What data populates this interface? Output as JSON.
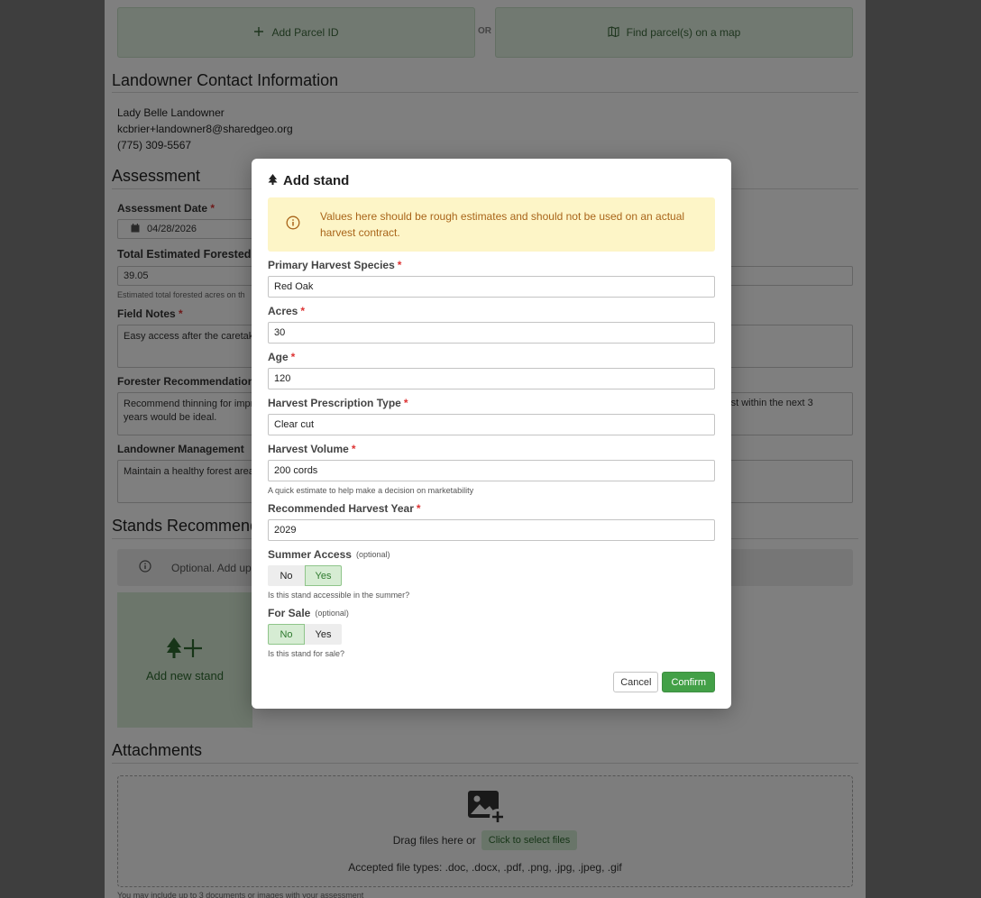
{
  "background": {
    "add_parcel_label": "Add Parcel ID",
    "or_label": "OR",
    "find_parcels_label": "Find parcel(s) on a map",
    "landowner_heading": "Landowner Contact Information",
    "landowner_name": "Lady Belle Landowner",
    "landowner_email": "kcbrier+landowner8@sharedgeo.org",
    "landowner_phone": "(775) 309-5567",
    "assessment_heading": "Assessment",
    "assessment_date_label": "Assessment Date",
    "assessment_date_value": "04/28/2026",
    "forested_acres_label": "Total Estimated Forested",
    "forested_acres_value": "39.05",
    "forested_acres_help": "Estimated total forested acres on th",
    "field_notes_label": "Field Notes",
    "field_notes_value": "Easy access after the caretak",
    "forester_rec_label": "Forester Recommendation",
    "forester_rec_value": "Recommend thinning for impr",
    "forester_rec_line2": "years would be ideal.",
    "forester_rec_tail": "vest within the next 3",
    "landowner_mgmt_label": "Landowner Management",
    "landowner_mgmt_value": "Maintain a healthy forest area",
    "stands_heading": "Stands Recommend",
    "stands_optional_text": "Optional. Add up",
    "add_new_stand_label": "Add new stand",
    "attachments_heading": "Attachments",
    "drag_files_text": "Drag files here or",
    "select_files_label": "Click to select files",
    "accepted_types_text": "Accepted file types: .doc, .docx, .pdf, .png, .jpg, .jpeg, .gif",
    "attachments_help": "You may include up to 3 documents or images with your assessment"
  },
  "modal": {
    "title": "Add stand",
    "alert_text": "Values here should be rough estimates and should not be used on an actual harvest contract.",
    "required_marker": "*",
    "optional_marker": "(optional)",
    "fields": {
      "species": {
        "label": "Primary Harvest Species",
        "value": "Red Oak"
      },
      "acres": {
        "label": "Acres",
        "value": "30"
      },
      "age": {
        "label": "Age",
        "value": "120"
      },
      "prescription": {
        "label": "Harvest Prescription Type",
        "value": "Clear cut"
      },
      "volume": {
        "label": "Harvest Volume",
        "value": "200 cords",
        "help": "A quick estimate to help make a decision on marketability"
      },
      "year": {
        "label": "Recommended Harvest Year",
        "value": "2029"
      }
    },
    "summer_access": {
      "label": "Summer Access",
      "no": "No",
      "yes": "Yes",
      "selected": "Yes",
      "help": "Is this stand accessible in the summer?"
    },
    "for_sale": {
      "label": "For Sale",
      "no": "No",
      "yes": "Yes",
      "selected": "No",
      "help": "Is this stand for sale?"
    },
    "cancel_label": "Cancel",
    "confirm_label": "Confirm"
  },
  "colors": {
    "accent_green": "#43a047",
    "alert_bg": "#fdf5c7",
    "alert_text": "#a9651a",
    "required_red": "#dd3333"
  },
  "icons": {
    "add_parcel": "plus-icon",
    "find_parcels": "map-icon",
    "modal_title": "tree-icon",
    "alert": "info-icon",
    "calendar": "calendar-icon",
    "add_stand": "tree-plus-icon",
    "dropzone": "image-plus-icon"
  }
}
